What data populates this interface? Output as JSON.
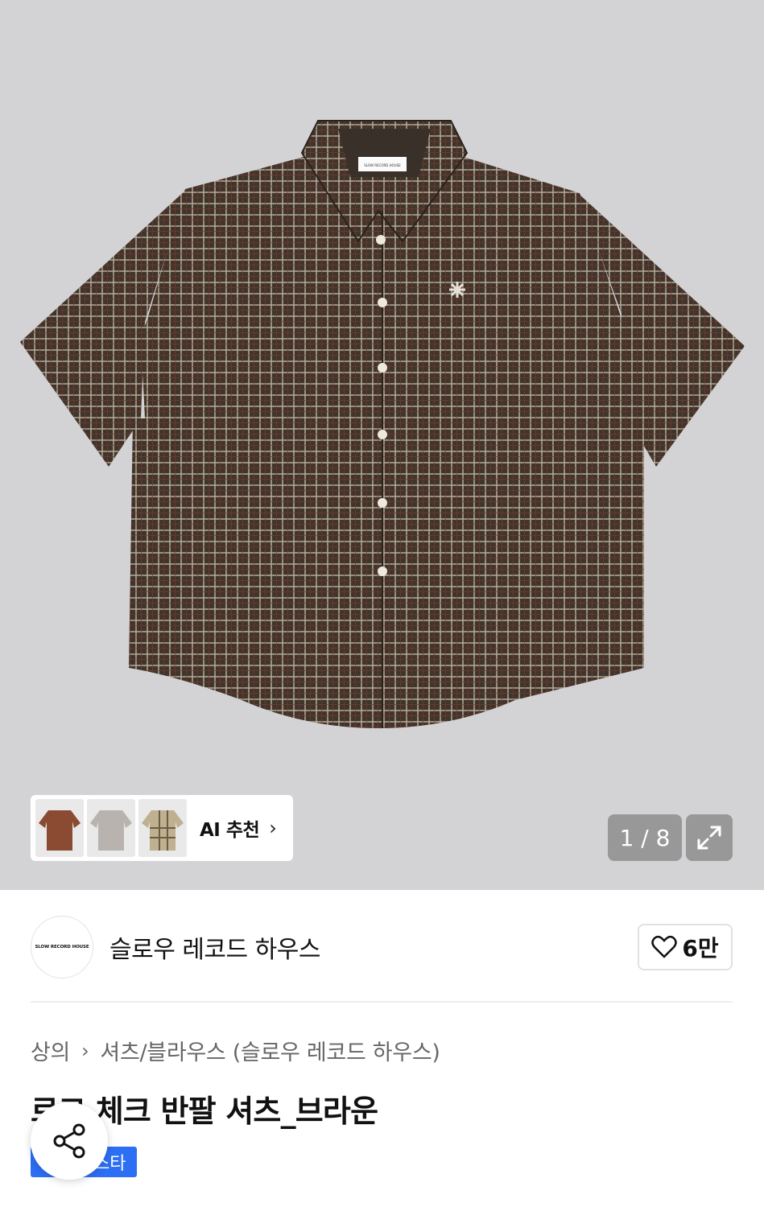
{
  "gallery": {
    "counter": "1 / 8",
    "product_image": "brown-check-short-sleeve-shirt",
    "neck_label_text": "SLOW RECORD HOUSE"
  },
  "ai_recommend": {
    "label": "AI 추천",
    "thumbnails": [
      "brown-shirt",
      "grey-shirt",
      "beige-check-shirt"
    ]
  },
  "brand": {
    "logo_text": "SLOW RECORD HOUSE",
    "name": "슬로우 레코드 하우스",
    "likes": "6만"
  },
  "breadcrumb": {
    "category": "상의",
    "subcategory": "셔츠/블라우스 (슬로우 레코드 하우스)"
  },
  "product": {
    "title": "로고 체크 반팔 셔츠_브라운",
    "tag": "스타"
  },
  "colors": {
    "hero_bg": "#d3d3d5",
    "tag_blue": "#2c6ff5",
    "shirt_brown": "#4a3f36"
  }
}
